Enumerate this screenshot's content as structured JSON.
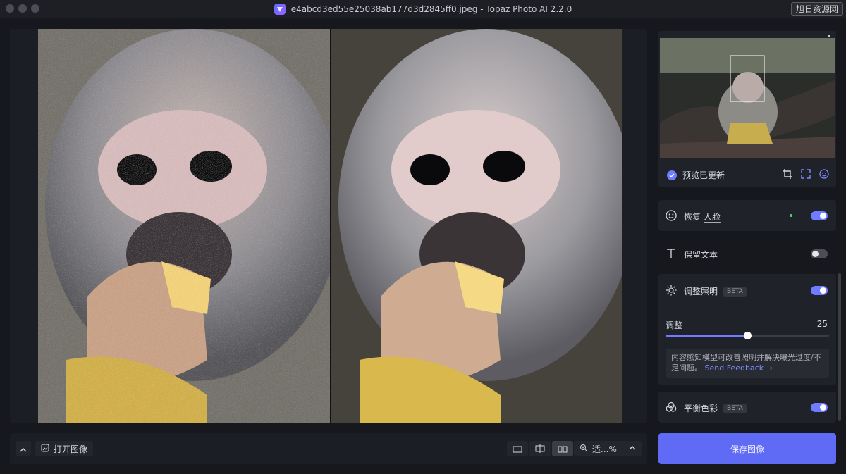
{
  "window": {
    "title": "e4abcd3ed55e25038ab177d3d2845ff0.jpeg - Topaz Photo AI 2.2.0",
    "watermark": "旭日资源网"
  },
  "viewer": {
    "left_image": "monkey-original",
    "right_image": "monkey-enhanced"
  },
  "preview": {
    "status": "预览已更新",
    "tools": [
      "crop-icon",
      "frame-icon",
      "face-icon"
    ]
  },
  "features": {
    "restore_face": {
      "label_prefix": "恢复",
      "label_emph": "人脸",
      "enabled": true
    },
    "preserve_text": {
      "label": "保留文本",
      "enabled": false
    },
    "adjust_lighting": {
      "label": "调整照明",
      "badge": "BETA",
      "enabled": true,
      "slider_label": "调整",
      "slider_value": "25",
      "slider_fraction": 0.5,
      "note": "内容感知模型可改善照明并解决曝光过度/不足问题。",
      "note_link": "Send Feedback →"
    },
    "balance_color": {
      "label": "平衡色彩",
      "badge": "BETA",
      "enabled": true
    }
  },
  "bottom_bar": {
    "open_image": "打开图像",
    "zoom": "适...%"
  },
  "save_button": "保存图像",
  "colors": {
    "accent": "#6f7cff",
    "save_bg": "#5f6bf5",
    "panel_bg": "#1f2228",
    "app_bg": "#16181d"
  }
}
